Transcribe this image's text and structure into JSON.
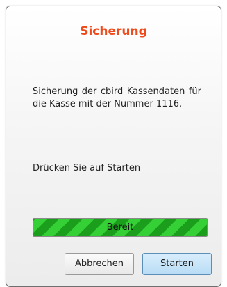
{
  "dialog": {
    "title": "Sicherung",
    "message": "Sicherung der cbird Kassendaten für die Kasse mit der Nummer 1116.",
    "hint": "Drücken Sie auf Starten",
    "progress": {
      "label": "Bereit",
      "value_percent": 100
    },
    "buttons": {
      "cancel_label": "Abbrechen",
      "start_label": "Starten"
    }
  },
  "colors": {
    "title": "#ef4a1c",
    "progress_stripe_dark": "#1b9e1b",
    "progress_stripe_light": "#35d035",
    "start_button": "#b8dcf5"
  }
}
